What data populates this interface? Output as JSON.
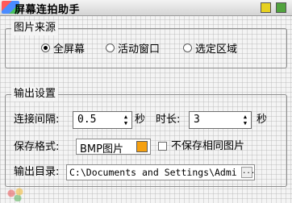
{
  "window": {
    "title": "屏幕连拍助手"
  },
  "source_group": {
    "title": "图片来源",
    "options": [
      {
        "label": "全屏幕",
        "selected": true
      },
      {
        "label": "活动窗口",
        "selected": false
      },
      {
        "label": "选定区域",
        "selected": false
      }
    ]
  },
  "output_group": {
    "title": "输出设置",
    "interval_label": "连接间隔:",
    "interval_value": "0.5",
    "interval_unit": "秒",
    "duration_label": "时长:",
    "duration_value": "3",
    "duration_unit": "秒",
    "format_label": "保存格式:",
    "format_value": "BMP图片",
    "no_duplicate_label": "不保存相同图片",
    "no_duplicate_checked": false,
    "dir_label": "输出目录:",
    "dir_value": "C:\\Documents and Settings\\Admi",
    "browse_label": "..."
  },
  "colors": {
    "minimize_button": "#e7d11f",
    "close_button": "#51a33d",
    "format_swatch": "#f5a010"
  }
}
